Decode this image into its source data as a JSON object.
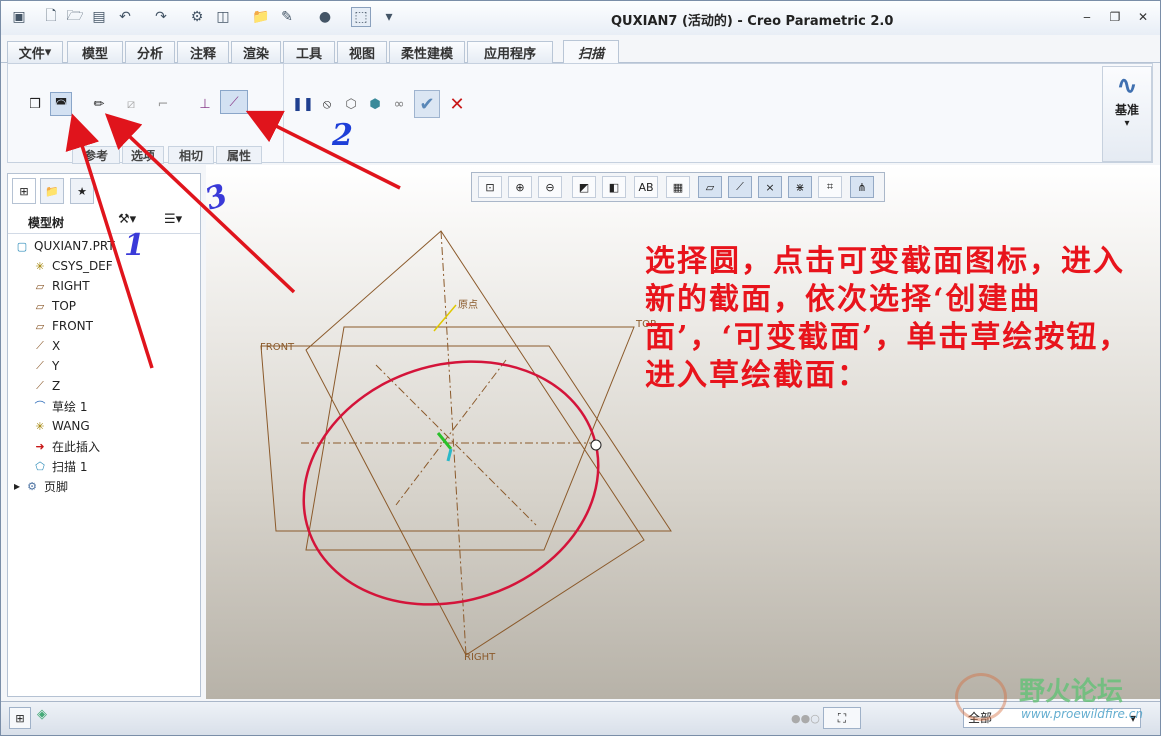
{
  "window": {
    "title": "QUXIAN7 (活动的) - Creo Parametric 2.0"
  },
  "quick_access": {
    "icons": [
      "new-icon",
      "open-icon",
      "save-icon",
      "undo-icon",
      "redo-icon",
      "regenerate-icon",
      "windows-icon",
      "folder-icon",
      "measure-icon",
      "appearance-icon",
      "display-icon",
      "customize-icon"
    ]
  },
  "tabs": [
    {
      "label": "文件",
      "active": false
    },
    {
      "label": "模型",
      "active": false
    },
    {
      "label": "分析",
      "active": false
    },
    {
      "label": "注释",
      "active": false
    },
    {
      "label": "渲染",
      "active": false
    },
    {
      "label": "工具",
      "active": false
    },
    {
      "label": "视图",
      "active": false
    },
    {
      "label": "柔性建模",
      "active": false
    },
    {
      "label": "应用程序",
      "active": false
    },
    {
      "label": "扫描",
      "active": true
    }
  ],
  "ribbon": {
    "groups": [
      "参考",
      "选项",
      "相切",
      "属性"
    ],
    "datum_label": "基准"
  },
  "left_panel": {
    "title": "模型树"
  },
  "tree": [
    {
      "label": "QUXIAN7.PRT",
      "icon": "part-icon",
      "indent": 0
    },
    {
      "label": "CSYS_DEF",
      "icon": "csys-icon",
      "indent": 1
    },
    {
      "label": "RIGHT",
      "icon": "plane-icon",
      "indent": 1
    },
    {
      "label": "TOP",
      "icon": "plane-icon",
      "indent": 1
    },
    {
      "label": "FRONT",
      "icon": "plane-icon",
      "indent": 1
    },
    {
      "label": "X",
      "icon": "axis-icon",
      "indent": 1
    },
    {
      "label": "Y",
      "icon": "axis-icon",
      "indent": 1
    },
    {
      "label": "Z",
      "icon": "axis-icon",
      "indent": 1
    },
    {
      "label": "草绘 1",
      "icon": "sketch-icon",
      "indent": 1
    },
    {
      "label": "WANG",
      "icon": "csys-icon",
      "indent": 1
    },
    {
      "label": "在此插入",
      "icon": "insert-arrow-icon",
      "indent": 1
    },
    {
      "label": "扫描 1",
      "icon": "sweep-icon",
      "indent": 1
    },
    {
      "label": "页脚",
      "icon": "footer-icon",
      "indent": 0
    }
  ],
  "viewport": {
    "plane_labels": {
      "front": "FRONT",
      "top": "TOP",
      "right": "RIGHT",
      "origin": "原点"
    },
    "note": "选择圆，点击可变截面图标，进入新的截面，依次选择‘创建曲面’，‘可变截面’，单击草绘按钮，进入草绘截面：",
    "annotations": [
      "1",
      "2",
      "3"
    ],
    "colors": {
      "curve": "#d4143a",
      "planes": "#8b5a2b",
      "note": "#e8141c",
      "arrow": "#e0141c"
    }
  },
  "statusbar": {
    "filter_value": "全部"
  },
  "watermark": {
    "text": "野火论坛",
    "url": "www.proewildfire.cn"
  }
}
